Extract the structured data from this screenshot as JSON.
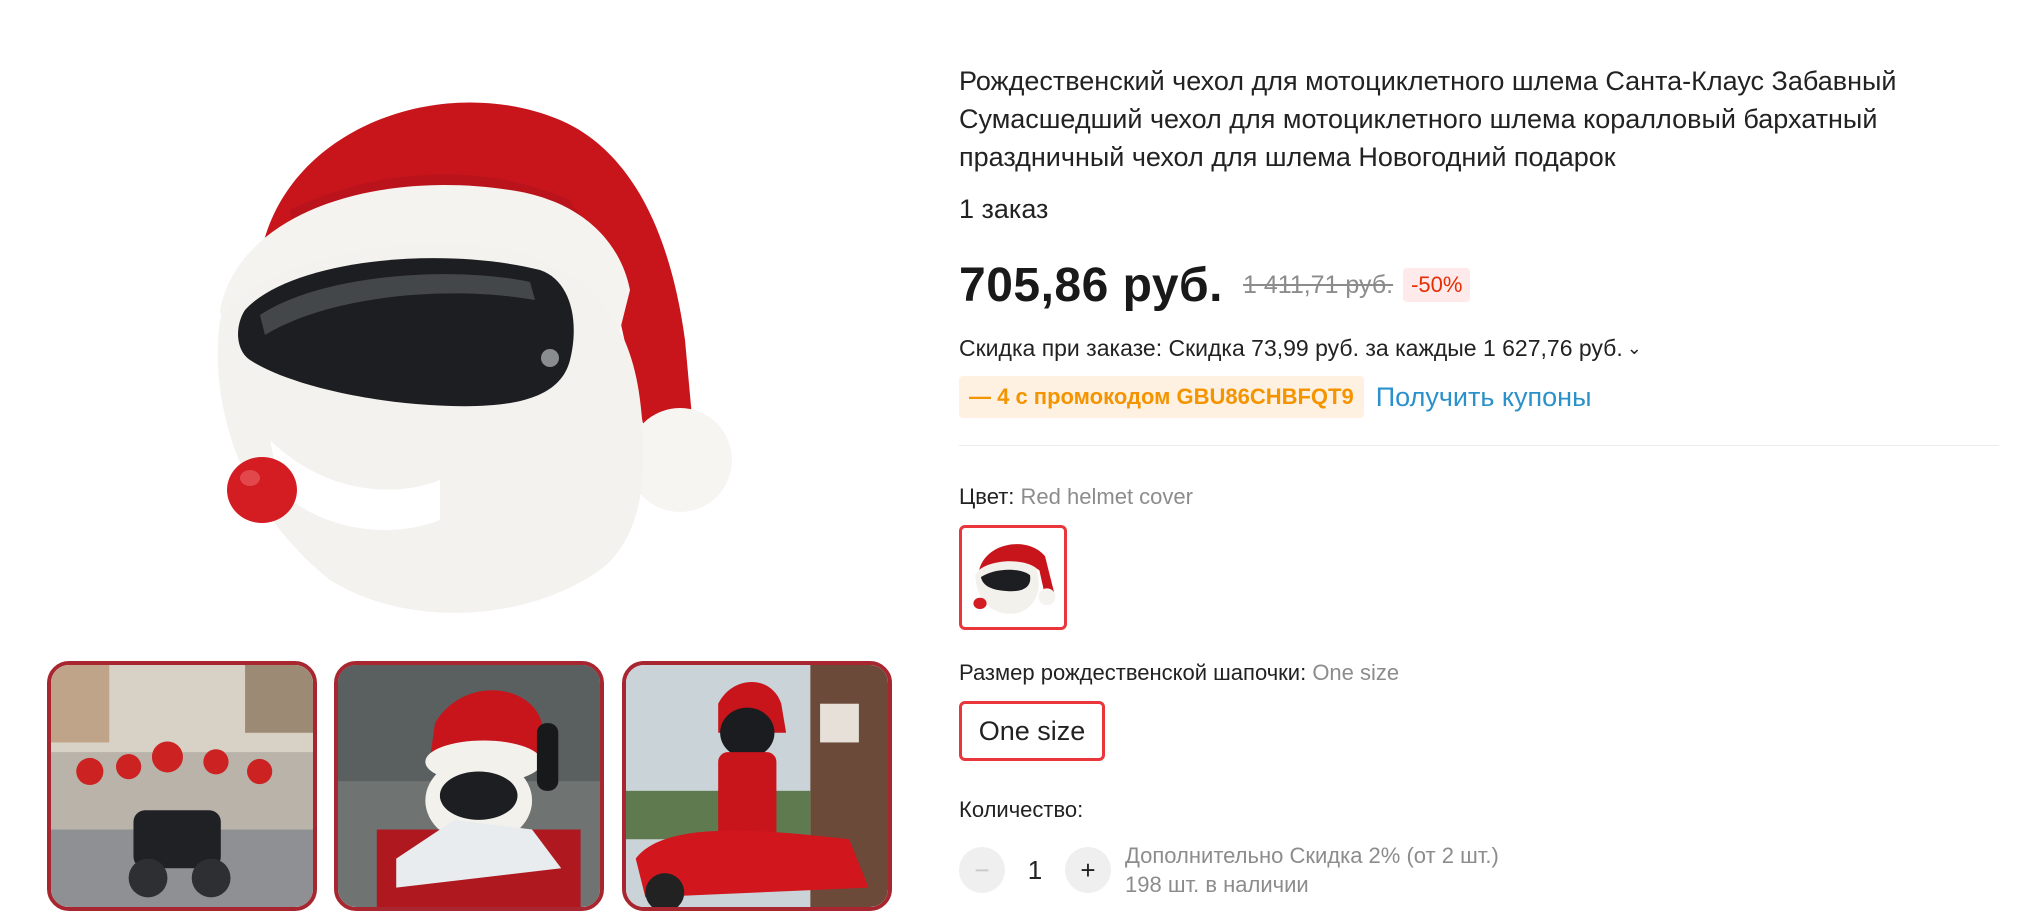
{
  "product": {
    "title": "Рождественский чехол для мотоциклетного шлема Санта-Клаус Забавный Сумасшедший чехол для мотоциклетного шлема коралловый бархатный праздничный чехол для шлема Новогодний подарок",
    "orders": "1 заказ",
    "price_current": "705,86 руб.",
    "price_old": "1 411,71 руб.",
    "discount": "-50%",
    "bulk_discount": "Скидка при заказе: Скидка 73,99 руб. за каждые 1 627,76 руб.",
    "promo_code": "— 4 с промокодом GBU86CHBFQT9",
    "coupons_link": "Получить купоны"
  },
  "options": {
    "color_label": "Цвет:",
    "color_value": "Red helmet cover",
    "size_label": "Размер рождественской шапочки:",
    "size_value": "One size",
    "size_option": "One size"
  },
  "quantity": {
    "label": "Количество:",
    "minus": "−",
    "value": "1",
    "plus": "+",
    "extra_discount": "Дополнительно Скидка 2% (от 2 шт.)",
    "stock": "198 шт. в наличии"
  },
  "colors": {
    "accent_red": "#e8363a",
    "thumb_border": "#a82630",
    "link_blue": "#2a91ca",
    "promo_orange": "#f49400",
    "discount_red": "#e62e04"
  }
}
